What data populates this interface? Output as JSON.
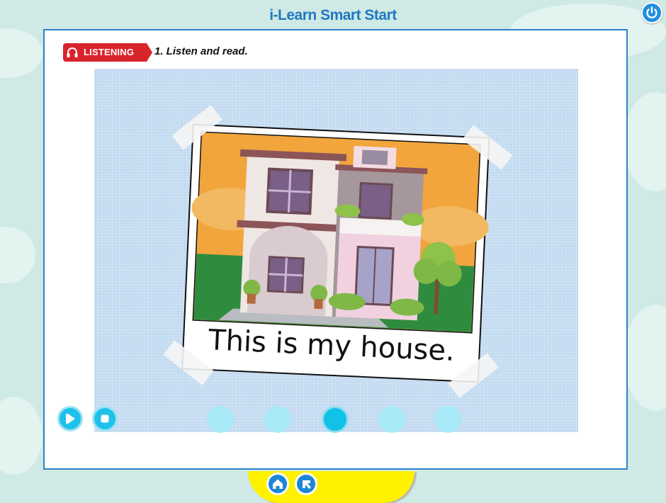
{
  "app": {
    "title": "i-Learn Smart Start"
  },
  "toolbar": {
    "power_icon": "power-icon"
  },
  "activity": {
    "section_badge": "LISTENING",
    "badge_icon": "headphones-icon",
    "instruction": "1. Listen and read."
  },
  "scene": {
    "caption": "This is my house."
  },
  "player": {
    "play_icon": "play-icon",
    "stop_icon": "stop-icon",
    "pages": [
      {
        "active": false
      },
      {
        "active": false
      },
      {
        "active": true
      },
      {
        "active": false
      },
      {
        "active": false
      }
    ]
  },
  "bottom_nav": {
    "home_icon": "home-icon",
    "back_icon": "back-arrow-icon"
  },
  "colors": {
    "accent": "#1f79c2",
    "badge": "#d9242b",
    "page_dot": "#a8eaf7",
    "page_dot_active": "#11c1e7",
    "bottom_tab": "#fff200"
  }
}
